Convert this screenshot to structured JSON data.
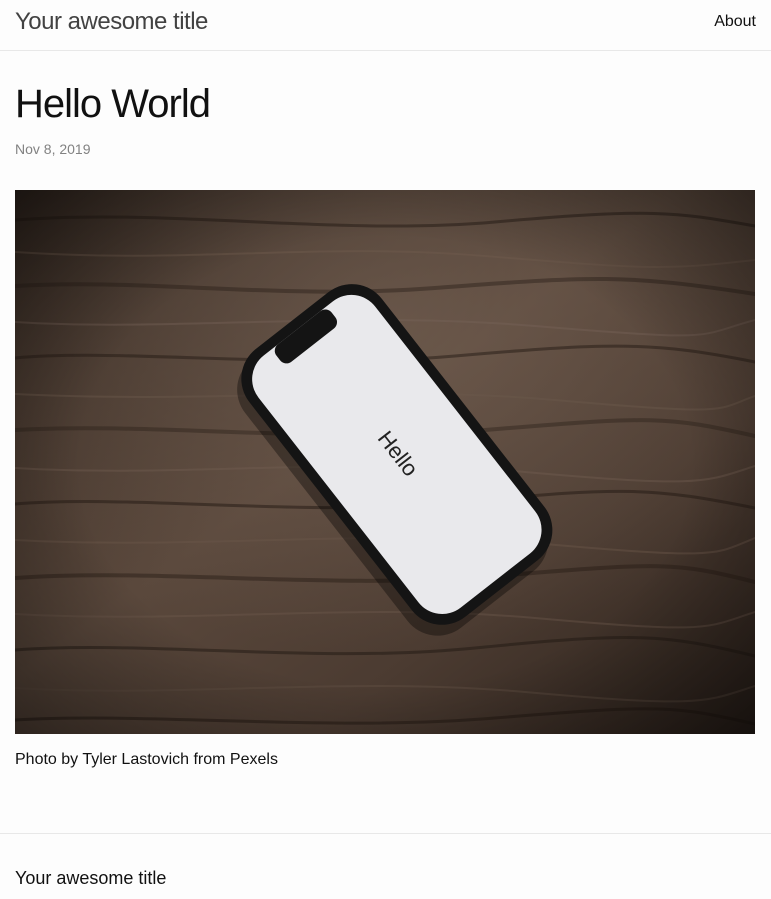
{
  "header": {
    "site_title": "Your awesome title",
    "nav": {
      "about": "About"
    }
  },
  "post": {
    "title": "Hello World",
    "date": "Nov 8, 2019",
    "image": {
      "screen_text": "Hello"
    },
    "caption": "Photo by Tyler Lastovich from Pexels"
  },
  "footer": {
    "heading": "Your awesome title"
  },
  "colors": {
    "background": "#fdfdfd",
    "text": "#111111",
    "site_title": "#424242",
    "meta": "#828282",
    "border": "#e8e8e8",
    "wood": "#4a3a30",
    "phone_screen": "#e9e9ec"
  }
}
